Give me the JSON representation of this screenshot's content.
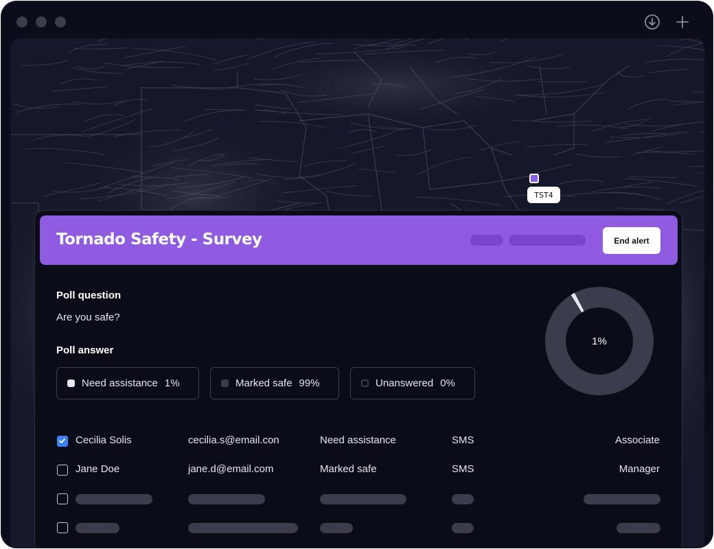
{
  "window": {
    "controls": [
      "close",
      "minimize",
      "maximize"
    ]
  },
  "toolbar": {
    "download_icon": "download-circle-icon",
    "add_icon": "plus-icon"
  },
  "map": {
    "marker_label": "TST4",
    "marker_color": "#8b5cf6"
  },
  "alert": {
    "title": "Tornado Safety - Survey",
    "end_button": "End alert",
    "header_color": "#8f5be0"
  },
  "poll": {
    "question_label": "Poll question",
    "question": "Are you safe?",
    "answer_label": "Poll answer",
    "answers": [
      {
        "label": "Need assistance",
        "percent": "1%",
        "color": "#e6e7ef"
      },
      {
        "label": "Marked safe",
        "percent": "99%",
        "color": "#3a3d4b"
      },
      {
        "label": "Unanswered",
        "percent": "0%",
        "color": "#0a0c18"
      }
    ],
    "donut_center": "1%",
    "donut_fraction": 0.01
  },
  "recipients": [
    {
      "name": "Cecilia Solis",
      "email": "cecilia.s@email.con",
      "status": "Need assistance",
      "channel": "SMS",
      "role": "Associate",
      "checked": true
    },
    {
      "name": "Jane Doe",
      "email": "jane.d@email.com",
      "status": "Marked safe",
      "channel": "SMS",
      "role": "Manager",
      "checked": false
    }
  ]
}
